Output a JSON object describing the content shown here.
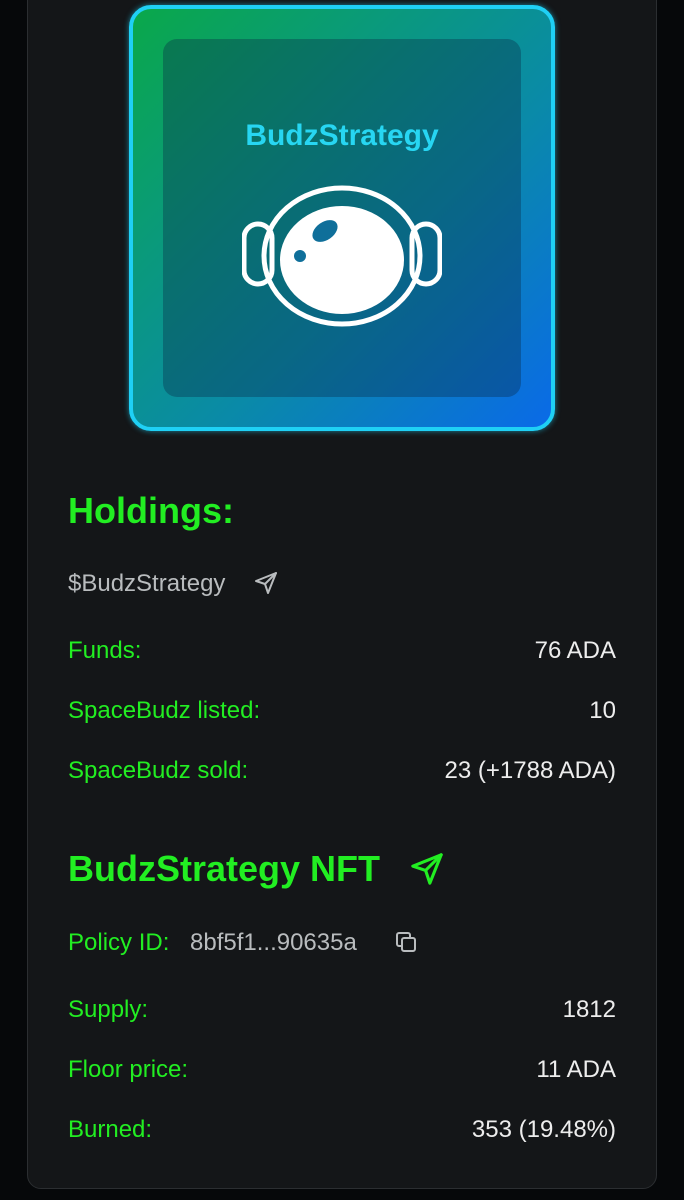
{
  "logo": {
    "title": "BudzStrategy",
    "icon": "astronaut-helmet-icon"
  },
  "holdings": {
    "heading": "Holdings:",
    "token": "$BudzStrategy",
    "token_icon": "send-icon",
    "rows": [
      {
        "label": "Funds:",
        "value": "76 ADA"
      },
      {
        "label": "SpaceBudz listed:",
        "value": "10"
      },
      {
        "label": "SpaceBudz sold:",
        "value": "23 (+1788 ADA)"
      }
    ]
  },
  "nft": {
    "heading": "BudzStrategy NFT",
    "heading_icon": "send-icon",
    "policy_label": "Policy ID:",
    "policy_value": "8bf5f1...90635a",
    "copy_icon": "copy-icon",
    "rows": [
      {
        "label": "Supply:",
        "value": "1812"
      },
      {
        "label": "Floor price:",
        "value": "11 ADA"
      },
      {
        "label": "Burned:",
        "value": "353 (19.48%)"
      }
    ]
  },
  "colors": {
    "accent_green": "#22ee22",
    "logo_border": "#1fd0f5",
    "card_background": "#141618"
  }
}
